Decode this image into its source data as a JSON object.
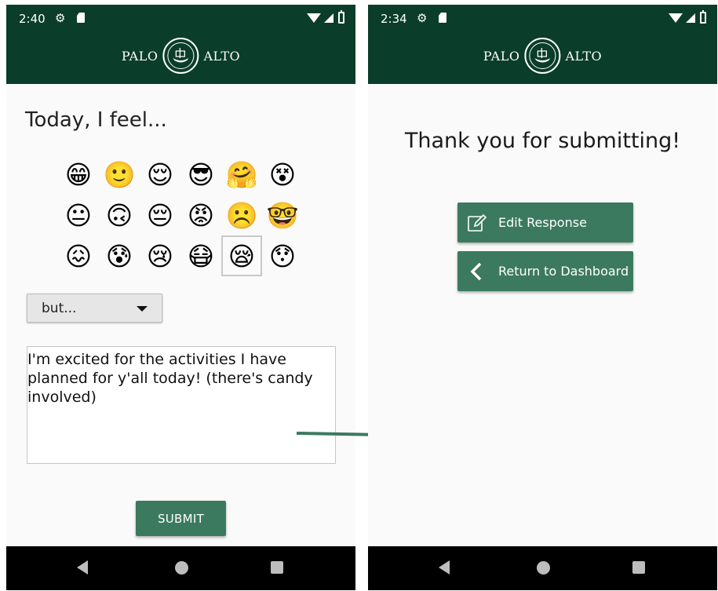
{
  "colors": {
    "header_bg": "#0a3d2a",
    "button_bg": "#3c7a5f",
    "screen_bg": "#fafafa",
    "arrow": "#3c7a5f"
  },
  "left_screen": {
    "status": {
      "time": "2:40"
    },
    "logo": {
      "left_word": "PALO",
      "right_word": "ALTO"
    },
    "title": "Today, I feel...",
    "emojis": [
      "😁",
      "🙂",
      "😌",
      "😎",
      "🤗",
      "😵",
      "😐",
      "🙃",
      "😔",
      "😡",
      "☹️",
      "🤓",
      "😖",
      "😰",
      "😢",
      "😷",
      "😪",
      "😯"
    ],
    "selected_emoji_index": 16,
    "dropdown": {
      "selected": "but..."
    },
    "response_text": "I'm excited for the activities I have planned for y'all today! (there's candy involved)",
    "submit_label": "SUBMIT"
  },
  "right_screen": {
    "status": {
      "time": "2:34"
    },
    "logo": {
      "left_word": "PALO",
      "right_word": "ALTO"
    },
    "message": "Thank you for submitting!",
    "edit_label": "Edit Response",
    "return_label": "Return to Dashboard"
  }
}
